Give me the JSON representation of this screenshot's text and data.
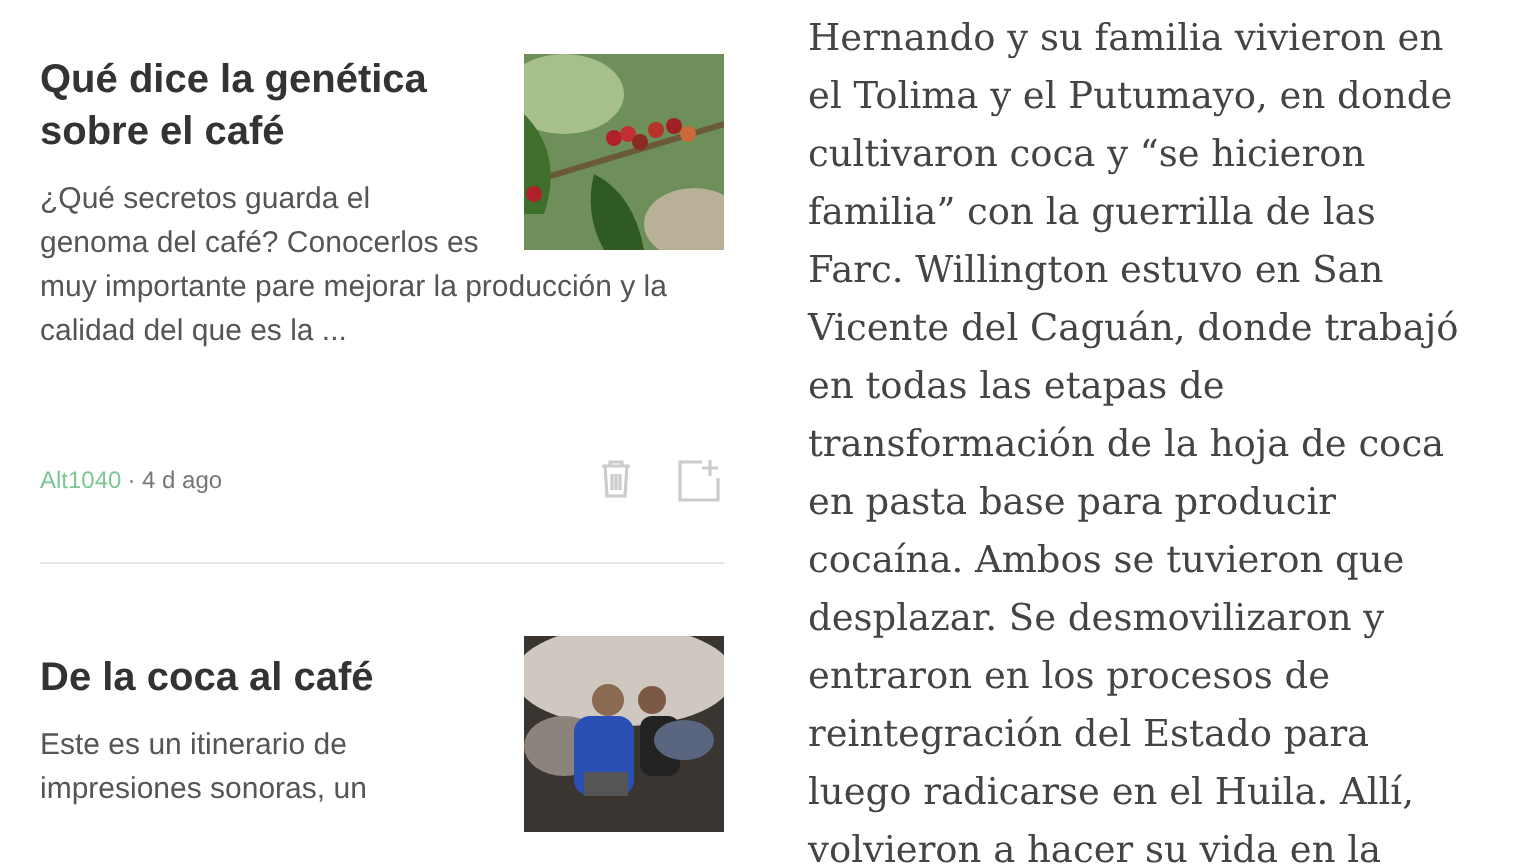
{
  "feed": [
    {
      "title": "Qué dice la genética sobre el café",
      "description": "¿Qué secretos guarda el genoma del café? Conocerlos es muy importante pare mejorar la producción y la calidad del que es la ...",
      "source": "Alt1040",
      "age": "· 4 d ago"
    },
    {
      "title": "De la coca al café",
      "description": "Este es un itinerario de impresiones sonoras, un"
    }
  ],
  "article": {
    "body": "Hernando y su familia vivieron en\nel Tolima y el Putumayo, en donde\ncultivaron coca y “se hicieron\nfamilia” con la guerrilla de las\nFarc. Willington estuvo en San\nVicente del Caguán, donde trabajó\nen todas las etapas de\ntransformación de la hoja de coca\nen pasta base para producir\ncocaína. Ambos se tuvieron que\ndesplazar. Se desmovilizaron y\nentraron en los procesos de\nreintegración del Estado para\nluego radicarse en el Huila. Allí,\nvolvieron a hacer su vida en la"
  }
}
